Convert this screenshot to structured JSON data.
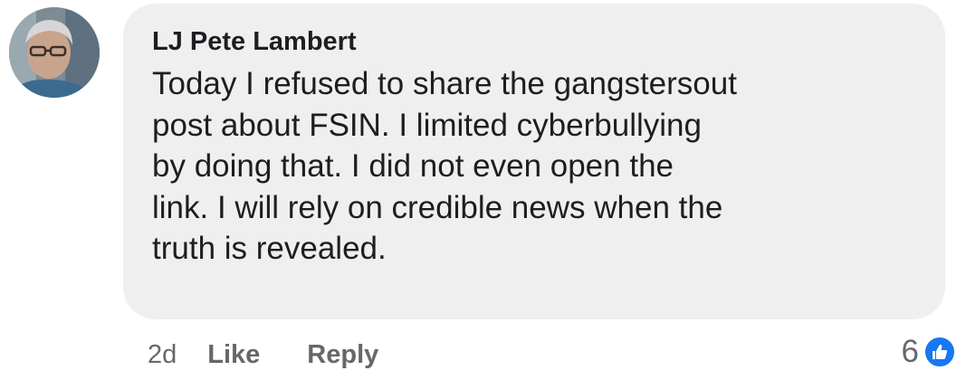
{
  "comment": {
    "author": "LJ Pete Lambert",
    "text": "Today I refused to share the gangstersout\npost  about FSIN. I limited cyberbullying\nby doing that.  I did not even open the\nlink. I will rely on credible news when the\ntruth is revealed."
  },
  "actions": {
    "age": "2d",
    "like_label": "Like",
    "reply_label": "Reply"
  },
  "reactions": {
    "count": "6",
    "icon": "thumbs-up-icon",
    "color": "#1877f2"
  }
}
